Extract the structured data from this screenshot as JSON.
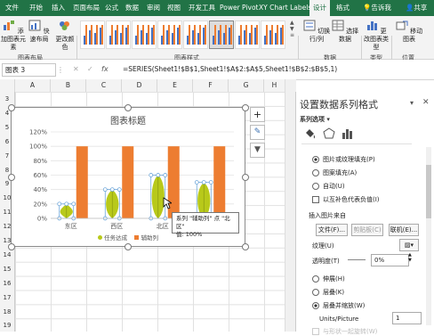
{
  "tabs": [
    "文件",
    "开始",
    "插入",
    "页面布局",
    "公式",
    "数据",
    "审阅",
    "视图",
    "开发工具",
    "Power Pivot",
    "XY Chart Labels",
    "设计",
    "格式"
  ],
  "tell_me": "告诉我",
  "share": "共享",
  "ribbon": {
    "add_element": "添加图表元素",
    "quick_layout": "快速布局",
    "change_color": "更改颜色",
    "group_layout": "图表布局",
    "group_styles": "图表样式",
    "switch_rowcol": "切换行/列",
    "select_data": "选择数据",
    "group_data": "数据",
    "change_type": "更改图表类型",
    "group_type": "类型",
    "move_chart": "移动图表",
    "group_location": "位置"
  },
  "formula_bar": {
    "name_box": "图表 3",
    "fx": "fx",
    "formula": "=SERIES(Sheet1!$B$1,Sheet1!$A$2:$A$5,Sheet1!$B$2:$B$5,1)"
  },
  "columns": [
    "A",
    "B",
    "C",
    "D",
    "E",
    "F",
    "G",
    "H"
  ],
  "rows": [
    "3",
    "4",
    "5",
    "6",
    "7",
    "8",
    "9",
    "10",
    "11",
    "12",
    "13",
    "14",
    "15",
    "16",
    "17",
    "18",
    "19"
  ],
  "chart_data": {
    "type": "bar",
    "title": "图表标题",
    "categories": [
      "东区",
      "西区",
      "北区",
      "南区"
    ],
    "series": [
      {
        "name": "任务达成",
        "values": [
          0.2,
          0.4,
          0.6,
          0.5
        ],
        "color": "#b8c91a"
      },
      {
        "name": "辅助列",
        "values": [
          1,
          1,
          1,
          1
        ],
        "color": "#ed7d31"
      }
    ],
    "y_ticks": [
      "0%",
      "20%",
      "40%",
      "60%",
      "80%",
      "100%",
      "120%"
    ],
    "ylim": [
      0,
      1.2
    ],
    "grid": true,
    "legend_position": "bottom"
  },
  "tooltip": {
    "line1": "系列 \"辅助列\" 点 \"北区\"",
    "line2": "值: 100%"
  },
  "pane": {
    "title": "设置数据系列格式",
    "subtitle": "系列选项",
    "fill_options": [
      "图片或纹理填充(P)",
      "图案填充(A)",
      "自动(U)"
    ],
    "invert_label": "以互补色代表负值(I)",
    "insert_from": "插入图片来自",
    "file_button": "文件(F)...",
    "clipboard_button": "剪贴板(C)",
    "online_button": "联机(E)...",
    "texture_label": "纹理(U)",
    "transparency_label": "透明度(T)",
    "transparency_value": "0%",
    "stack_options": [
      "伸展(H)",
      "层叠(K)",
      "层叠并缩放(W)"
    ],
    "units_label": "Units/Picture",
    "units_value": "1",
    "more_label": "与形状一起旋转(W)"
  },
  "colors": {
    "excel_green": "#217346",
    "bar_green": "#b8c91a",
    "bar_orange": "#ed7d31"
  }
}
